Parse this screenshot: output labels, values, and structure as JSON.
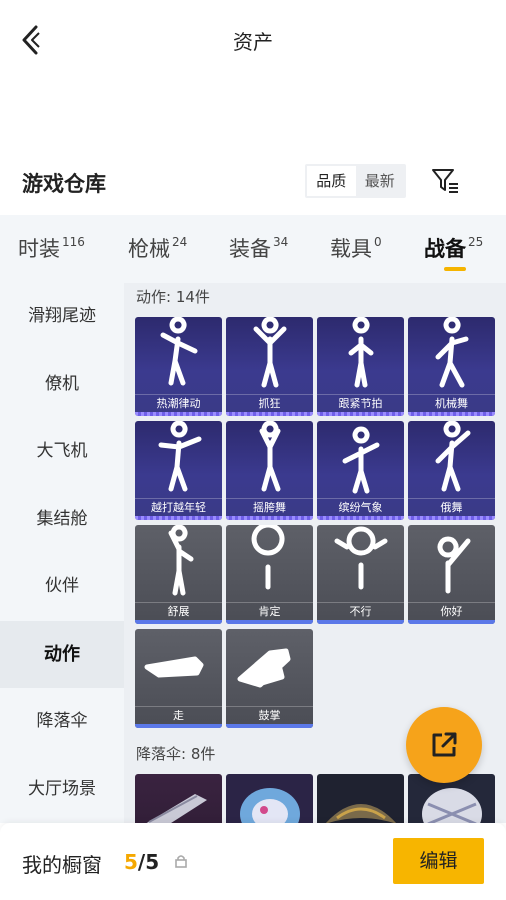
{
  "header": {
    "title": "资产"
  },
  "warehouse": {
    "title": "游戏仓库",
    "sort_options": [
      "品质",
      "最新"
    ],
    "active_sort": 0
  },
  "category_tabs": [
    {
      "label": "时装",
      "count": "116"
    },
    {
      "label": "枪械",
      "count": "24"
    },
    {
      "label": "装备",
      "count": "34"
    },
    {
      "label": "载具",
      "count": "0"
    },
    {
      "label": "战备",
      "count": "25",
      "active": true
    }
  ],
  "sidebar": {
    "items": [
      "滑翔尾迹",
      "僚机",
      "大飞机",
      "集结舱",
      "伙伴",
      "动作",
      "降落伞",
      "大厅场景"
    ],
    "active_index": 5
  },
  "sections": {
    "emotes": {
      "title": "动作: 14件"
    },
    "parachutes": {
      "title": "降落伞: 8件"
    }
  },
  "emotes": [
    {
      "name": "热潮律动",
      "style": "purple"
    },
    {
      "name": "抓狂",
      "style": "purple"
    },
    {
      "name": "跟紧节拍",
      "style": "purple"
    },
    {
      "name": "机械舞",
      "style": "purple"
    },
    {
      "name": "越打越年轻",
      "style": "purple"
    },
    {
      "name": "摇胯舞",
      "style": "purple"
    },
    {
      "name": "缤纷气象",
      "style": "purple"
    },
    {
      "name": "俄舞",
      "style": "purple"
    },
    {
      "name": "舒展",
      "style": "gray"
    },
    {
      "name": "肯定",
      "style": "gray"
    },
    {
      "name": "不行",
      "style": "gray"
    },
    {
      "name": "你好",
      "style": "gray"
    },
    {
      "name": "走",
      "style": "gray"
    },
    {
      "name": "鼓掌",
      "style": "gray"
    }
  ],
  "showcase": {
    "label": "我的橱窗",
    "current": "5",
    "separator": "/",
    "total": "5"
  },
  "edit_label": "编辑",
  "colors": {
    "accent": "#f7b500",
    "fab": "#f6a31a",
    "purple_card": "#33307c",
    "gray_card": "#55575f",
    "rarity_blue": "#5b78e8"
  }
}
